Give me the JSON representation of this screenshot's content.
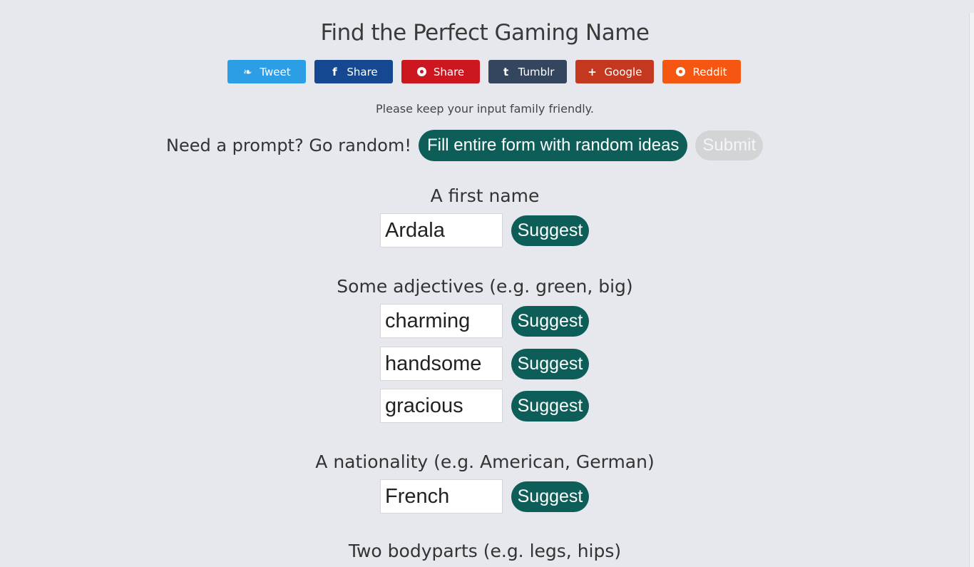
{
  "page": {
    "title": "Find the Perfect Gaming Name",
    "notice": "Please keep your input family friendly."
  },
  "share_buttons": [
    {
      "label": "Tweet",
      "icon": "twitter-icon",
      "glyph": "❧",
      "color": "#2b9ee5"
    },
    {
      "label": "Share",
      "icon": "facebook-icon",
      "glyph": "f",
      "color": "#154890"
    },
    {
      "label": "Share",
      "icon": "pinterest-icon",
      "glyph": "",
      "color": "#cc1721"
    },
    {
      "label": "Tumblr",
      "icon": "tumblr-icon",
      "glyph": "t",
      "color": "#34465d"
    },
    {
      "label": "Google",
      "icon": "google-plus-icon",
      "glyph": "+",
      "color": "#c4381f"
    },
    {
      "label": "Reddit",
      "icon": "reddit-icon",
      "glyph": "",
      "color": "#f55712"
    }
  ],
  "random": {
    "prompt": "Need a prompt? Go random!",
    "fill_button": "Fill entire form with random ideas",
    "submit_button": "Submit"
  },
  "fields": {
    "first_name": {
      "label": "A first name",
      "values": [
        "Ardala"
      ]
    },
    "adjectives": {
      "label": "Some adjectives (e.g. green, big)",
      "values": [
        "charming",
        "handsome",
        "gracious"
      ]
    },
    "nationality": {
      "label": "A nationality (e.g. American, German)",
      "values": [
        "French"
      ]
    },
    "bodyparts": {
      "label": "Two bodyparts (e.g. legs, hips)"
    }
  },
  "suggest_label": "Suggest",
  "colors": {
    "accent": "#0d5e58",
    "background": "#e6e8ed",
    "disabled": "#d3d4d6"
  }
}
